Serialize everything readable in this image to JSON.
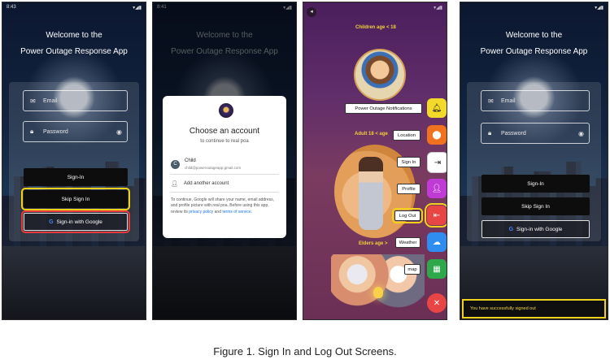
{
  "screen1": {
    "status_time": "8:43",
    "title_line1": "Welcome to the",
    "title_line2": "Power Outage Response App",
    "email_placeholder": "Email",
    "password_placeholder": "Password",
    "sign_in": "Sign-In",
    "skip": "Skip Sign In",
    "google": "Sign-in with Google"
  },
  "screen2": {
    "status_time": "8:41",
    "title_line1": "Welcome to the",
    "title_line2": "Power Outage Response App",
    "dialog_title": "Choose an account",
    "dialog_sub": "to continue to real poa",
    "account_initial": "C",
    "account_name": "Child",
    "account_email": "child@poweroutageapp.gmail.com",
    "add_account": "Add another account",
    "note_text": "To continue, Google will share your name, email address, and profile picture with real poa. Before using this app, review its",
    "privacy_link": "privacy policy",
    "and_text": "and",
    "terms_link": "terms of service",
    "end_text": "."
  },
  "screen3": {
    "children_label": "Children age < 18",
    "adult_label": "Adult 18 < age",
    "elders_label": "Elders age >",
    "buttons": {
      "notifications": "Power Outage Notifications",
      "location": "Location",
      "signin": "Sign In",
      "profile": "Profile",
      "logout": "Log Out",
      "weather": "Weather",
      "map": "map"
    }
  },
  "screen4": {
    "title_line1": "Welcome to the",
    "title_line2": "Power Outage Response App",
    "email_placeholder": "Email",
    "password_placeholder": "Password",
    "sign_in": "Sign-In",
    "skip": "Skip Sign In",
    "google": "Sign-in with Google",
    "toast": "You have successfully signed out"
  },
  "caption": "Figure 1. Sign In and Log Out Screens.",
  "colors": {
    "highlight_yellow": "#f2d11c",
    "highlight_red": "#e63b3b",
    "fab_yellow": "#f3d92a",
    "fab_orange": "#f0721e",
    "fab_purple": "#c03ad6",
    "fab_red": "#e84545",
    "fab_blue": "#2f8cf0",
    "fab_green": "#2ea84a"
  }
}
